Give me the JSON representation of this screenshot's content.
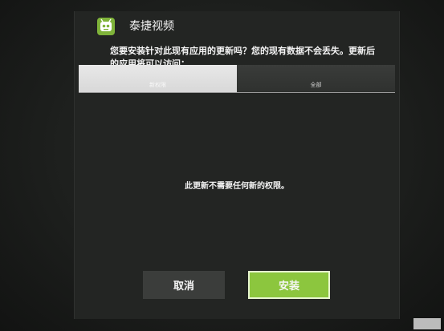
{
  "app": {
    "title": "泰捷视频",
    "icon": "robot-app-icon"
  },
  "message": "您要安装针对此现有应用的更新吗？您的现有数据不会丢失。更新后的应用将可以访问：",
  "tabs": [
    {
      "label": "新权限",
      "selected": true
    },
    {
      "label": "全部",
      "selected": false
    }
  ],
  "content": {
    "text": "此更新不需要任何新的权限。"
  },
  "buttons": {
    "cancel": "取消",
    "install": "安装"
  },
  "colors": {
    "accent": "#8cc63e",
    "dialog_bg": "#232523",
    "tab_selected_bg": "#e0e0e0"
  },
  "watermark": ""
}
